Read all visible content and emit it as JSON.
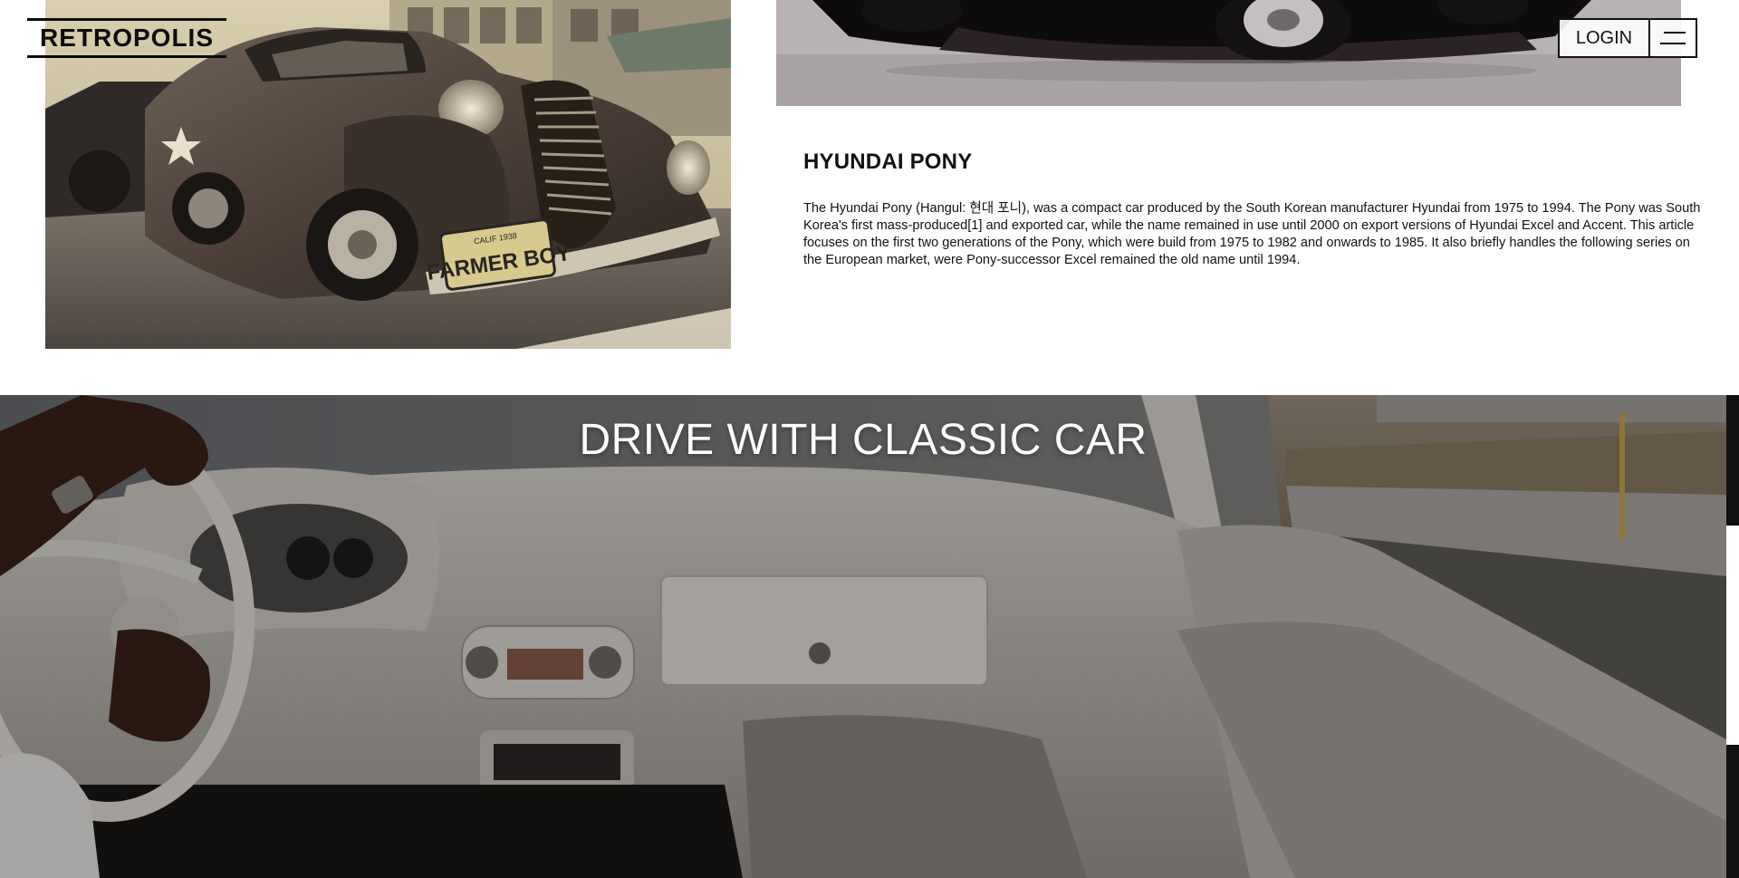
{
  "header": {
    "logo_text": "RETROPOLIS",
    "login_label": "LOGIN",
    "menu_icon": "hamburger-icon"
  },
  "images": {
    "farmer_car": {
      "description_icon": "vintage-car-photo",
      "plate_top": "CALIF 1938",
      "plate_text": "FARMER BOY"
    },
    "pony_car": {
      "description_icon": "car-photo-strip"
    },
    "hero": {
      "description_icon": "car-interior-photo"
    }
  },
  "article": {
    "title": "HYUNDAI PONY",
    "body": "The Hyundai Pony (Hangul: 현대 포니), was a compact car produced by the South Korean manufacturer Hyundai from 1975 to 1994. The Pony was South Korea's first mass-produced[1] and exported car, while the name remained in use until 2000 on export versions of Hyundai Excel and Accent. This article focuses on the first two generations of the Pony, which were build from 1975 to 1982 and onwards to 1985. It also briefly handles the following series on the European market, were Pony-successor Excel remained the old name until 1994."
  },
  "hero": {
    "title": "DRIVE WITH CLASSIC CAR"
  },
  "colors": {
    "text_primary": "#111111",
    "background": "#ffffff",
    "hero_overlay": "#2b2a28"
  }
}
